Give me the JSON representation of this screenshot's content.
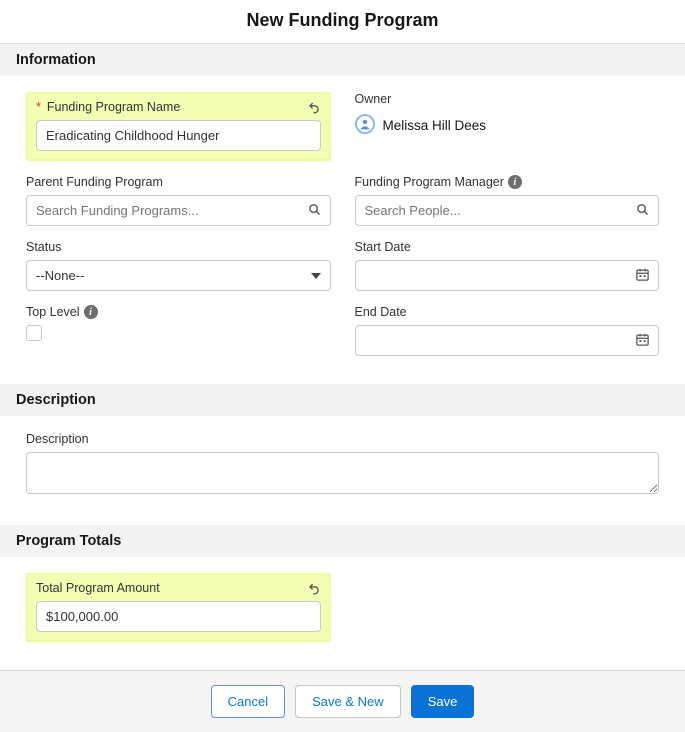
{
  "header": {
    "title": "New Funding Program"
  },
  "sections": {
    "information": {
      "heading": "Information"
    },
    "description_section": {
      "heading": "Description"
    },
    "program_totals": {
      "heading": "Program Totals"
    }
  },
  "fields": {
    "funding_program_name": {
      "label": "Funding Program Name",
      "value": "Eradicating Childhood Hunger"
    },
    "owner": {
      "label": "Owner",
      "value": "Melissa Hill Dees"
    },
    "parent_funding_program": {
      "label": "Parent Funding Program",
      "placeholder": "Search Funding Programs..."
    },
    "funding_program_manager": {
      "label": "Funding Program Manager",
      "placeholder": "Search People..."
    },
    "status": {
      "label": "Status",
      "value": "--None--"
    },
    "start_date": {
      "label": "Start Date",
      "value": ""
    },
    "top_level": {
      "label": "Top Level"
    },
    "end_date": {
      "label": "End Date",
      "value": ""
    },
    "description": {
      "label": "Description",
      "value": ""
    },
    "total_program_amount": {
      "label": "Total Program Amount",
      "value": "$100,000.00"
    }
  },
  "footer": {
    "cancel": "Cancel",
    "save_new": "Save & New",
    "save": "Save"
  }
}
